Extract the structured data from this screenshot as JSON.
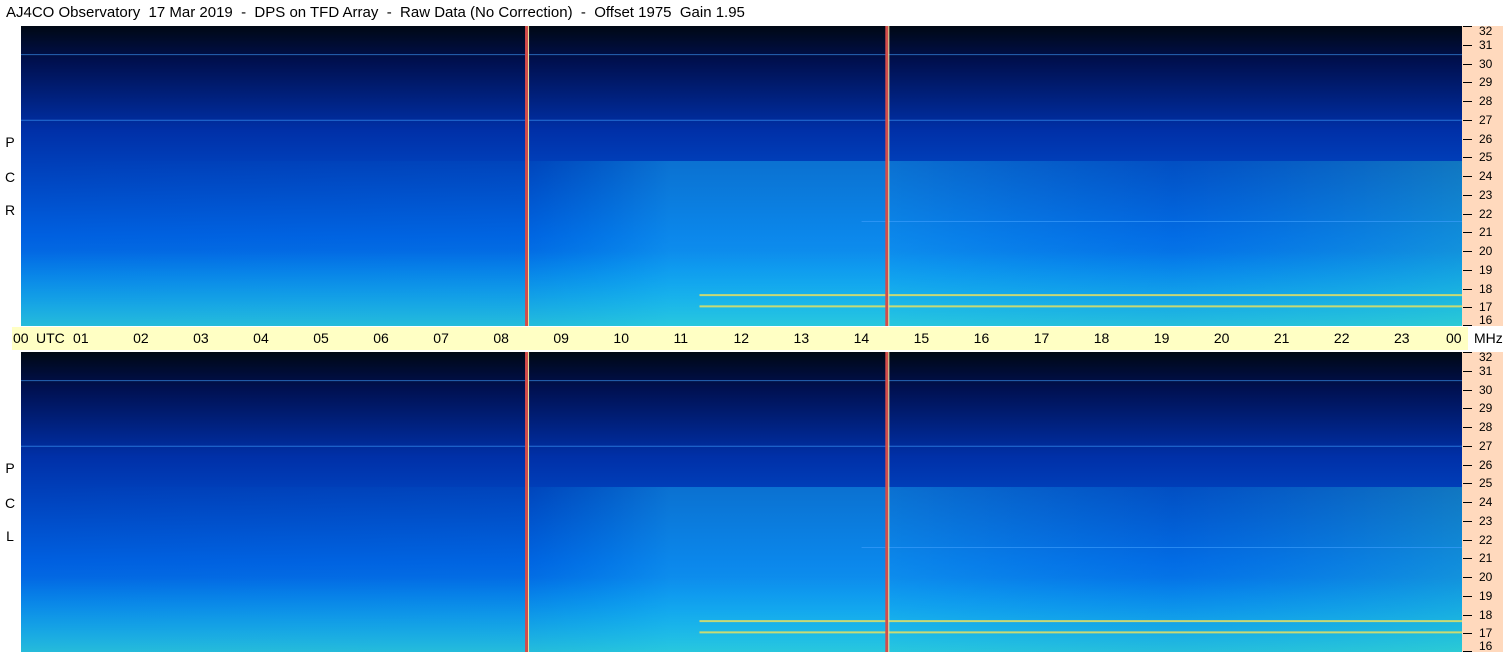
{
  "title": "AJ4CO Observatory  17 Mar 2019  -  DPS on TFD Array  -  Raw Data (No Correction)  -  Offset 1975  Gain 1.95",
  "chart_data": {
    "type": "heatmap",
    "description_panels": [
      {
        "name": "R C P"
      },
      {
        "name": "L C P"
      }
    ],
    "x": {
      "unit": "UTC",
      "tick_labels": [
        "00",
        "01",
        "02",
        "03",
        "04",
        "05",
        "06",
        "07",
        "08",
        "09",
        "10",
        "11",
        "12",
        "13",
        "14",
        "15",
        "16",
        "17",
        "18",
        "19",
        "20",
        "21",
        "22",
        "23",
        "00"
      ],
      "range": [
        0,
        24
      ]
    },
    "y": {
      "unit": "MHz",
      "tick_labels": [
        "16",
        "17",
        "18",
        "19",
        "20",
        "21",
        "22",
        "23",
        "24",
        "25",
        "26",
        "27",
        "28",
        "29",
        "30",
        "31",
        "32"
      ],
      "range": [
        16,
        32
      ]
    },
    "vertical_markers_utc": [
      8.42,
      14.42
    ],
    "interference_bands_mhz": [
      17.1,
      17.7,
      21.6,
      27.0,
      30.5
    ]
  },
  "side_labels": {
    "top": [
      "R",
      "C",
      "P"
    ],
    "bottom": [
      "L",
      "C",
      "P"
    ]
  },
  "timebar": {
    "utc_label": "UTC",
    "mhz_label": "MHz"
  },
  "colors": {
    "timebar": "#ffffc4",
    "freq_column": "#ffd9bd",
    "marker": "#d24c4c"
  }
}
